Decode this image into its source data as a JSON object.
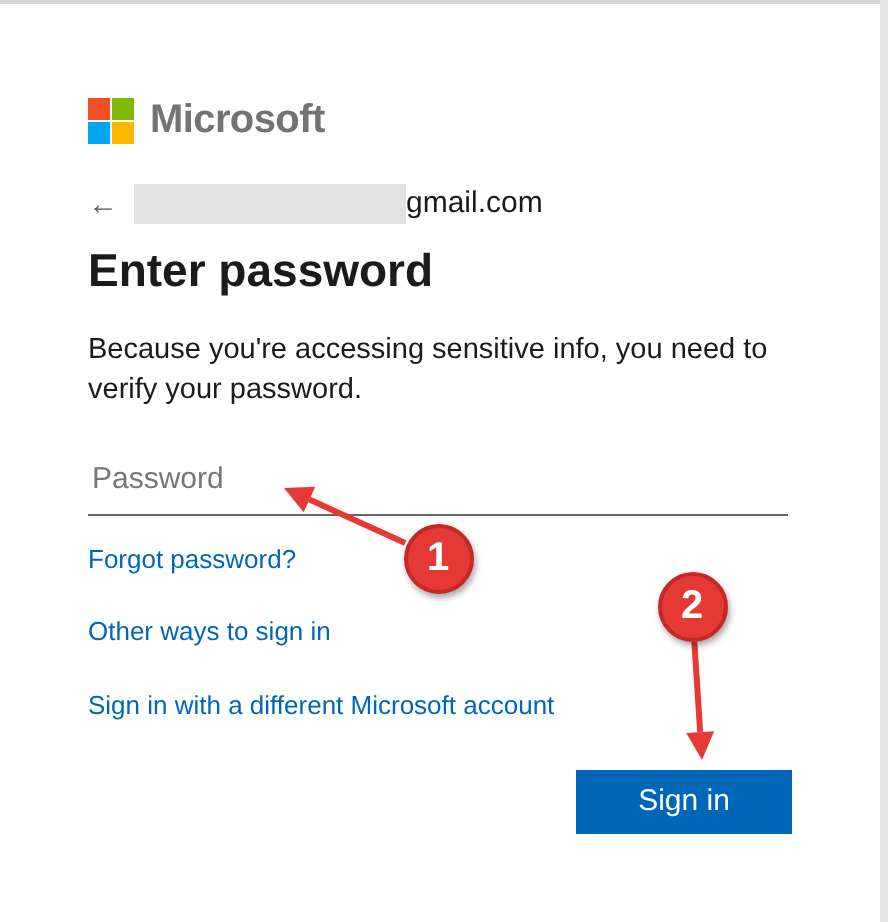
{
  "brand": {
    "name": "Microsoft"
  },
  "account": {
    "back": "←",
    "email_visible": "gmail.com",
    "redacted": true
  },
  "heading": "Enter password",
  "description": "Because you're accessing sensitive info, you need to verify your password.",
  "password_field": {
    "placeholder": "Password"
  },
  "links": [
    "Forgot password?",
    "Other ways to sign in",
    "Sign in with a different Microsoft account"
  ],
  "buttons": [
    {
      "label": "Sign in",
      "kind": "primary"
    }
  ],
  "annotations": [
    {
      "label": "1"
    },
    {
      "label": "2"
    }
  ]
}
